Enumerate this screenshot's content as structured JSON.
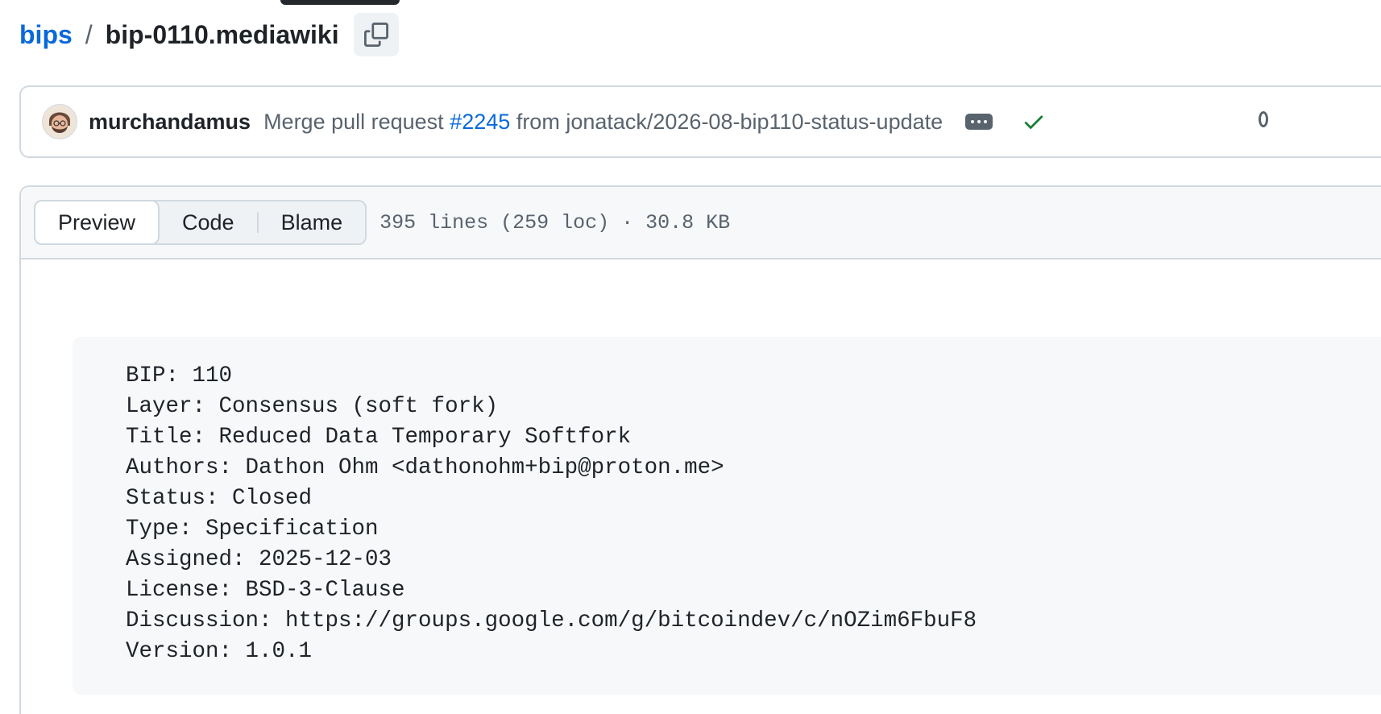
{
  "breadcrumb": {
    "repo": "bips",
    "separator": "/",
    "file": "bip-0110.mediawiki"
  },
  "commit": {
    "author": "murchandamus",
    "message_prefix": "Merge pull request",
    "pr_number": "#2245",
    "message_suffix": "from jonatack/2026-08-bip110-status-update",
    "status": "success"
  },
  "file_view": {
    "tabs": [
      {
        "label": "Preview",
        "active": true
      },
      {
        "label": "Code",
        "active": false
      },
      {
        "label": "Blame",
        "active": false
      }
    ],
    "meta": "395 lines (259 loc) · 30.8 KB"
  },
  "preamble": {
    "lines": [
      "BIP: 110",
      "Layer: Consensus (soft fork)",
      "Title: Reduced Data Temporary Softfork",
      "Authors: Dathon Ohm <dathonohm+bip@proton.me>",
      "Status: Closed",
      "Type: Specification",
      "Assigned: 2025-12-03",
      "License: BSD-3-Clause",
      "Discussion: https://groups.google.com/g/bitcoindev/c/nOZim6FbuF8",
      "Version: 1.0.1"
    ]
  },
  "colors": {
    "link": "#0969da",
    "success": "#1a7f37",
    "border": "#d1d9e0",
    "muted_text": "#59636e",
    "header_bg": "#f6f8fa"
  }
}
